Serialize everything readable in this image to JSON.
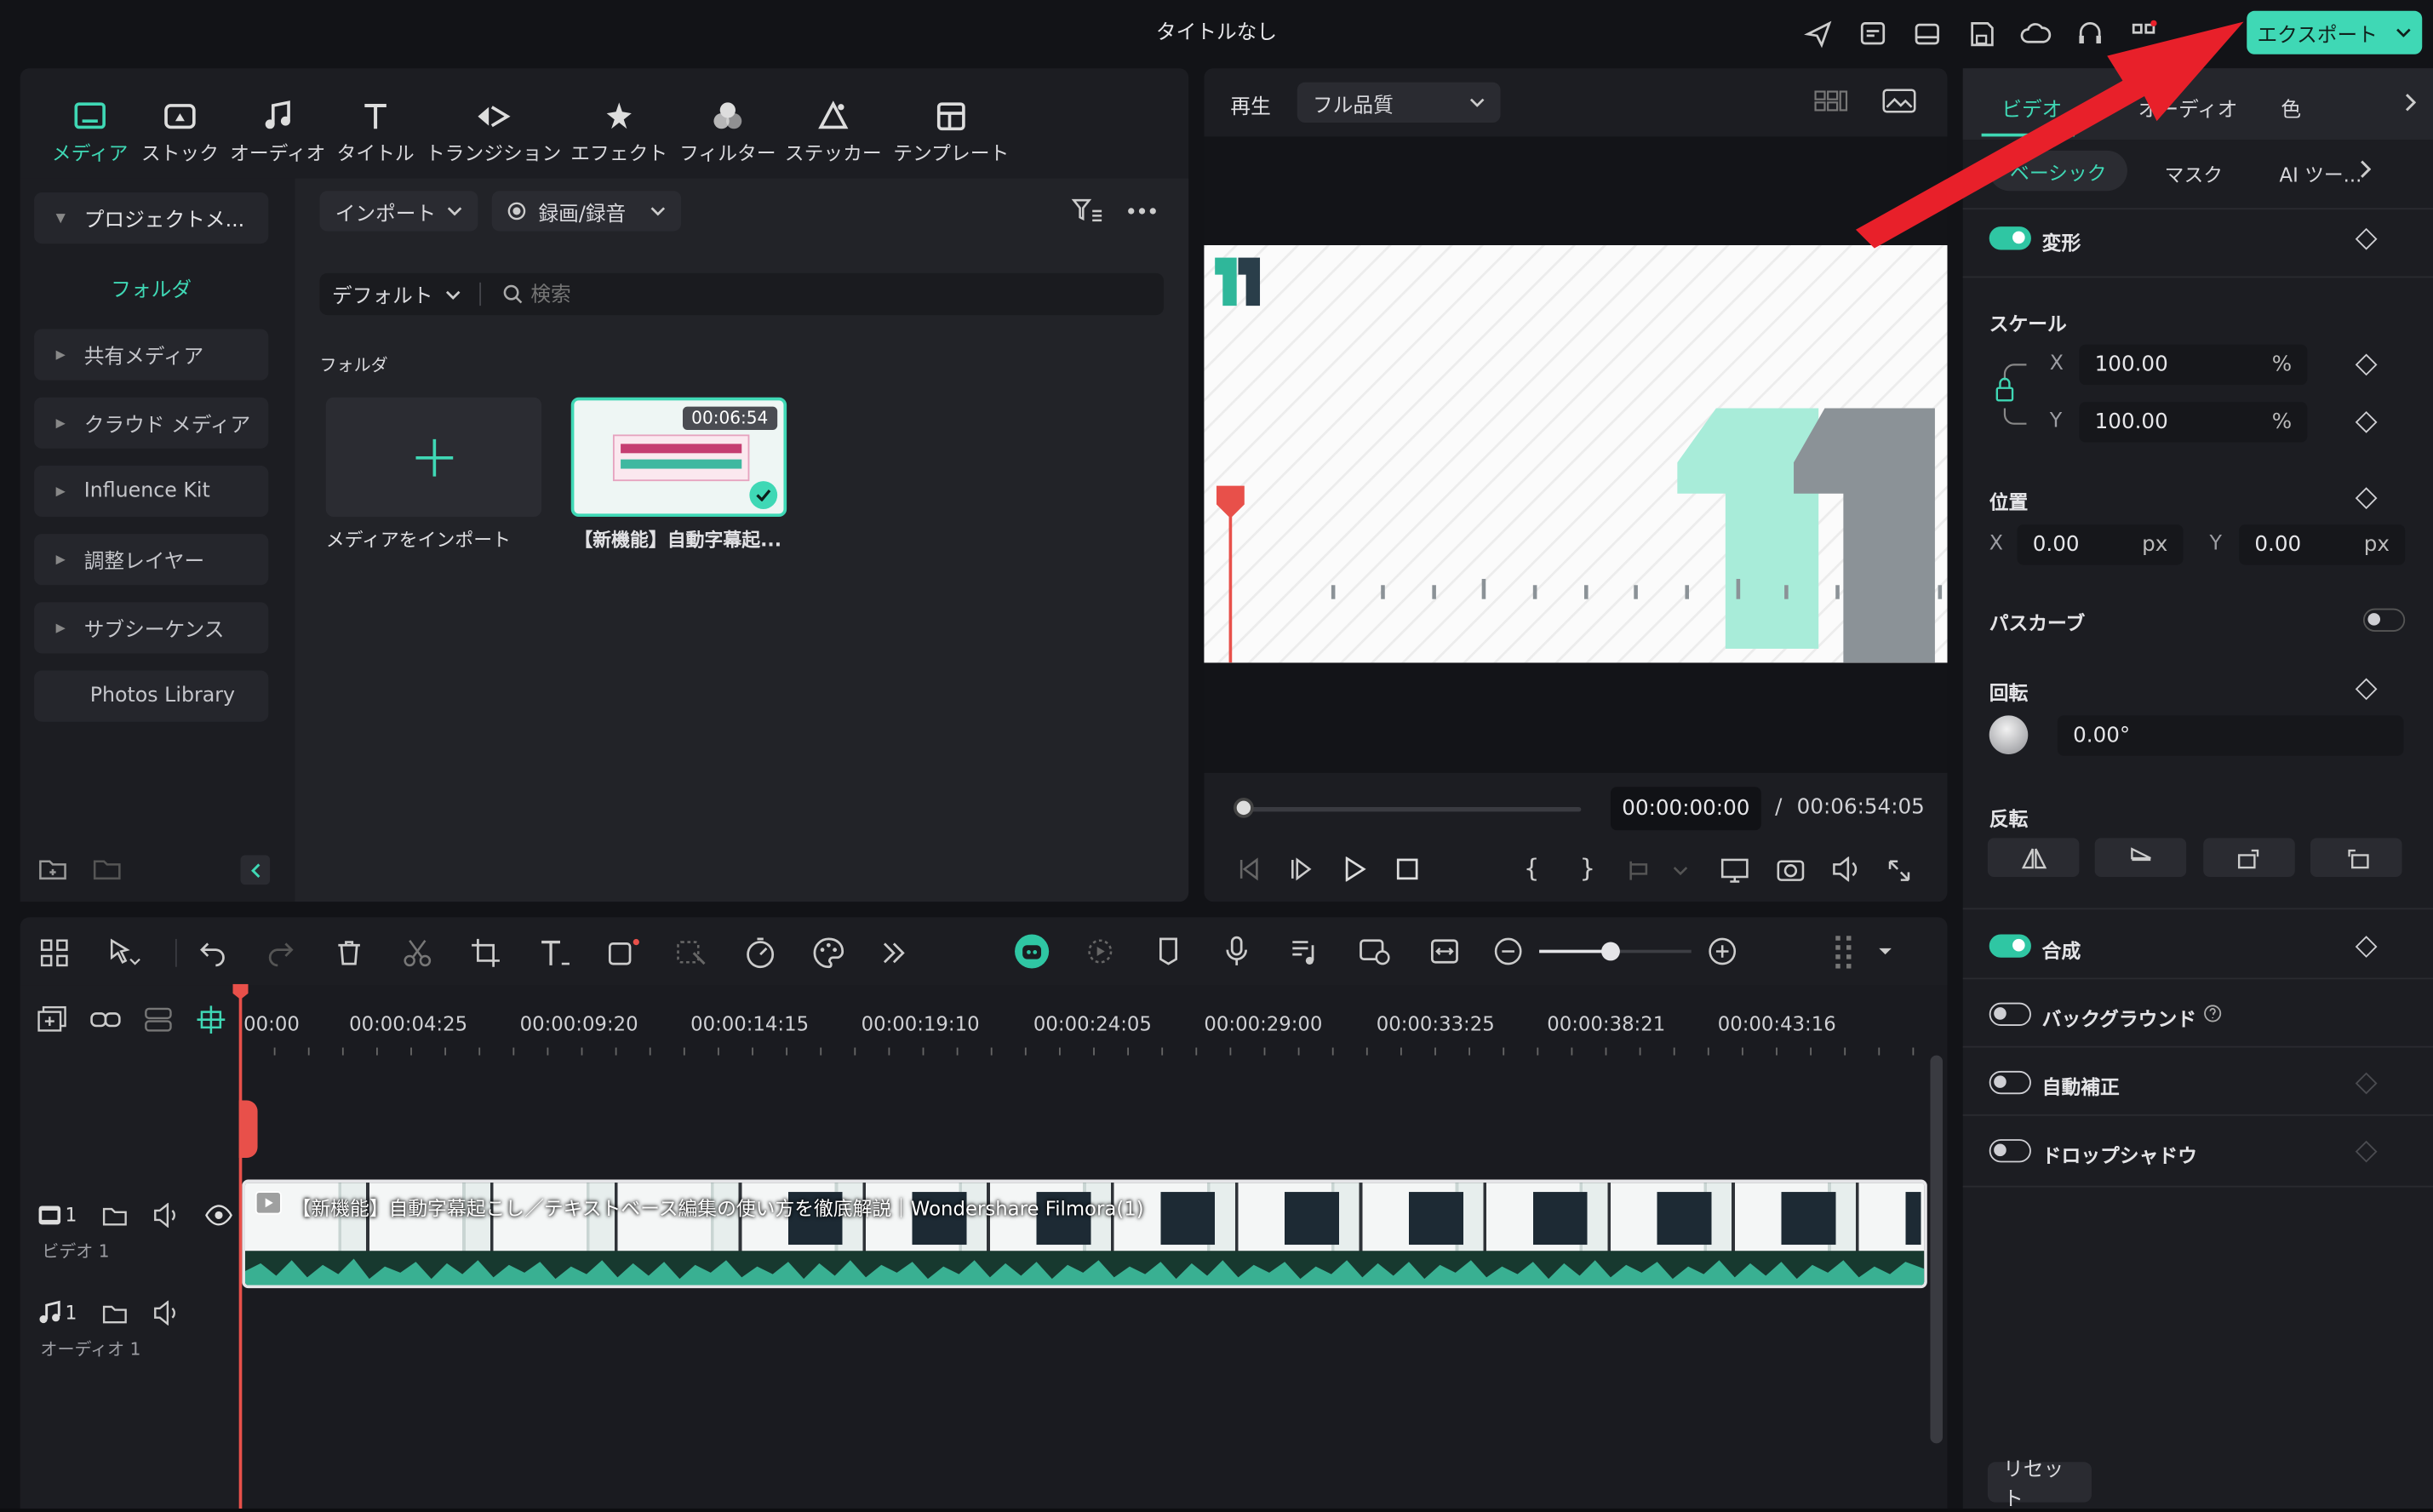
{
  "window": {
    "title": "タイトルなし",
    "export_label": "エクスポート"
  },
  "media_toolbar": [
    {
      "label": "メディア",
      "icon": "media-icon"
    },
    {
      "label": "ストック",
      "icon": "stock-icon"
    },
    {
      "label": "オーディオ",
      "icon": "music-icon"
    },
    {
      "label": "タイトル",
      "icon": "title-icon"
    },
    {
      "label": "トランジション",
      "icon": "transition-icon"
    },
    {
      "label": "エフェクト",
      "icon": "effect-icon"
    },
    {
      "label": "フィルター",
      "icon": "filter-icon"
    },
    {
      "label": "ステッカー",
      "icon": "sticker-icon"
    },
    {
      "label": "テンプレート",
      "icon": "template-icon"
    }
  ],
  "sidebar": {
    "project": "プロジェクトメ...",
    "folder": "フォルダ",
    "items": [
      "共有メディア",
      "クラウド メディア",
      "Influence Kit",
      "調整レイヤー",
      "サブシーケンス",
      "Photos Library"
    ]
  },
  "library": {
    "import_label": "インポート",
    "record_label": "録画/録音",
    "sort_label": "デフォルト",
    "search_placeholder": "検索",
    "section": "フォルダ",
    "import_media_label": "メディアをインポート",
    "clip_name": "【新機能】自動字幕起...",
    "clip_duration": "00:06:54"
  },
  "player": {
    "mode_label": "再生",
    "quality_label": "フル品質",
    "current_time": "00:00:00:00",
    "separator": "/",
    "total_time": "00:06:54:05",
    "brace_open": "{",
    "brace_close": "}"
  },
  "inspector": {
    "tabs": [
      "ビデオ",
      "オーディオ",
      "色"
    ],
    "subtabs": [
      "ベーシック",
      "マスク",
      "AI ツー..."
    ],
    "transform_label": "変形",
    "scale_label": "スケール",
    "x_axis": "X",
    "y_axis": "Y",
    "scale_x": "100.00",
    "scale_y": "100.00",
    "percent": "%",
    "position_label": "位置",
    "pos_x": "0.00",
    "pos_y": "0.00",
    "px": "px",
    "path_curve_label": "パスカーブ",
    "rotation_label": "回転",
    "rotation_value": "0.00°",
    "flip_label": "反転",
    "composite_label": "合成",
    "background_label": "バックグラウンド",
    "auto_enhance_label": "自動補正",
    "drop_shadow_label": "ドロップシャドウ",
    "reset_label": "リセット"
  },
  "timeline": {
    "ruler": [
      "00:00",
      "00:00:04:25",
      "00:00:09:20",
      "00:00:14:15",
      "00:00:19:10",
      "00:00:24:05",
      "00:00:29:00",
      "00:00:33:25",
      "00:00:38:21",
      "00:00:43:16"
    ],
    "video_track_num": "1",
    "video_track_label": "ビデオ 1",
    "audio_track_num": "1",
    "audio_track_label": "オーディオ 1",
    "clip_title": "【新機能】自動字幕起こし／テキストベース編集の使い方を徹底解説｜Wondershare Filmora(1)",
    "zoom_level": 0.47
  },
  "colors": {
    "accent": "#2fc6a3",
    "annotation_arrow": "#e8202a",
    "playhead": "#e8504a"
  }
}
